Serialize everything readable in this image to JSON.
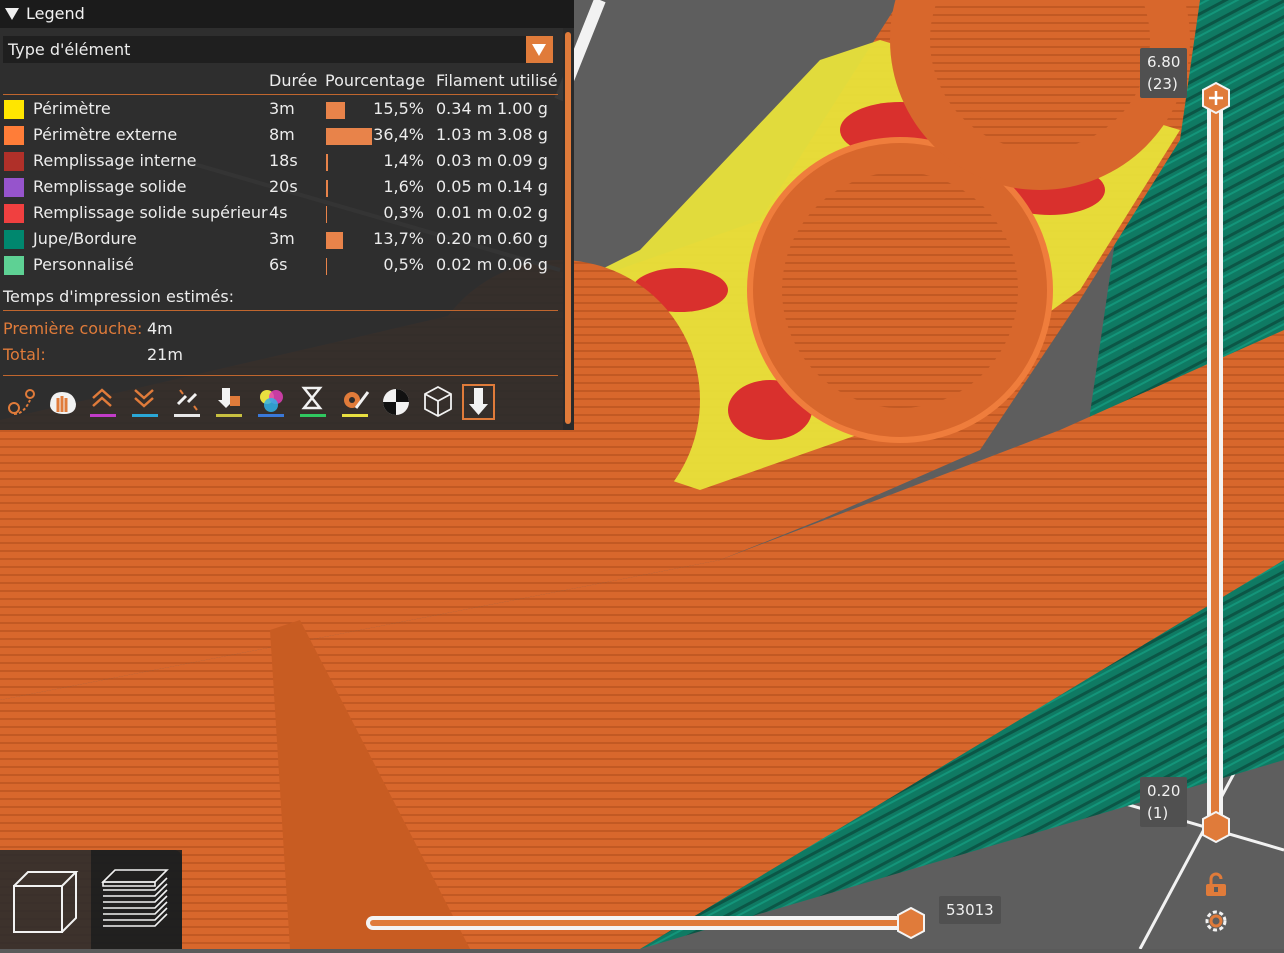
{
  "legend": {
    "title": "Legend",
    "view_type": "Type d'élément",
    "columns": {
      "duration": "Durée",
      "percent": "Pourcentage",
      "filament": "Filament utilisé"
    },
    "rows": [
      {
        "name": "Périmètre",
        "color": "#ffe600",
        "duration": "3m",
        "percent": "15,5%",
        "percent_value": 15.5,
        "length": "0.34 m",
        "weight": "1.00 g"
      },
      {
        "name": "Périmètre externe",
        "color": "#ff7d38",
        "duration": "8m",
        "percent": "36,4%",
        "percent_value": 36.4,
        "length": "1.03 m",
        "weight": "3.08 g"
      },
      {
        "name": "Remplissage interne",
        "color": "#b03029",
        "duration": "18s",
        "percent": "1,4%",
        "percent_value": 1.4,
        "length": "0.03 m",
        "weight": "0.09 g"
      },
      {
        "name": "Remplissage solide",
        "color": "#9654cc",
        "duration": "20s",
        "percent": "1,6%",
        "percent_value": 1.6,
        "length": "0.05 m",
        "weight": "0.14 g"
      },
      {
        "name": "Remplissage solide supérieur",
        "color": "#f04040",
        "duration": "4s",
        "percent": "0,3%",
        "percent_value": 0.3,
        "length": "0.01 m",
        "weight": "0.02 g"
      },
      {
        "name": "Jupe/Bordure",
        "color": "#00876e",
        "duration": "3m",
        "percent": "13,7%",
        "percent_value": 13.7,
        "length": "0.20 m",
        "weight": "0.60 g"
      },
      {
        "name": "Personnalisé",
        "color": "#5ed194",
        "duration": "6s",
        "percent": "0,5%",
        "percent_value": 0.5,
        "length": "0.02 m",
        "weight": "0.06 g"
      }
    ],
    "estimates": {
      "title": "Temps d'impression estimés:",
      "first_layer_label": "Première couche:",
      "first_layer_value": "4m",
      "total_label": "Total:",
      "total_value": "21m"
    },
    "toolbar_icons": [
      "travel-icon",
      "wipe-icon",
      "retractions-icon",
      "deretractions-icon",
      "seams-icon",
      "tool-changes-icon",
      "color-changes-icon",
      "pause-icon",
      "custom-gcode-icon",
      "center-of-gravity-icon",
      "shells-icon",
      "tool-marker-icon"
    ]
  },
  "vertical_slider": {
    "top_value": "6.80",
    "top_layer": "(23)",
    "bottom_value": "0.20",
    "bottom_layer": "(1)"
  },
  "horizontal_slider": {
    "value": "53013"
  },
  "colors": {
    "accent": "#e07b3a",
    "panel": "#2c2c2c"
  }
}
